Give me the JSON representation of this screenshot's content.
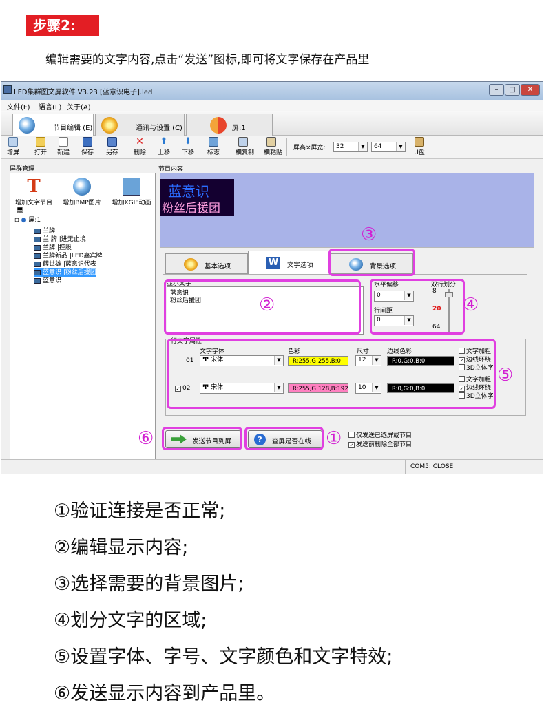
{
  "step": {
    "badge": "步骤2:",
    "instruction": "编辑需要的文字内容,点击“发送”图标,即可将文字保存在产品里"
  },
  "window": {
    "title": "LED集群图文屏软件 V3.23 [蓝意识电子].led",
    "menu": [
      "文件(F)",
      "语言(L)",
      "关于(A)"
    ],
    "tabs": [
      {
        "label": "节目编辑 (E)",
        "icon": "palette-icon"
      },
      {
        "label": "通讯与设置 (C)",
        "icon": "gear-icon"
      },
      {
        "label": "屏:1",
        "icon": "refresh-icon"
      }
    ],
    "toolbar": [
      "增屏",
      "打开",
      "新建",
      "保存",
      "另存",
      "删除",
      "上移",
      "下移",
      "标志",
      "横复制",
      "横粘贴"
    ],
    "screen_size": {
      "label": "屏高×屏宽:",
      "height": "32",
      "width": "64"
    },
    "udisk": "U盘"
  },
  "left_panel": {
    "title": "屏群管理",
    "tools": [
      "增加文字节目",
      "增加BMP图片",
      "增加XGIF动画"
    ],
    "tree_root": "屏:1",
    "programs": [
      "兰牌",
      "兰 牌 |进无止境",
      "兰牌 |控股",
      "兰牌新品 |LED嘉宾牌",
      "薛世雄 |蓝意识代表",
      "蓝意识 |粉丝后援团",
      "蓝意识"
    ],
    "selected_index": 5
  },
  "content": {
    "title": "节目内容",
    "preview_line1": "蓝意识",
    "preview_line2": "粉丝后援团",
    "prop_tabs": [
      "基本选项",
      "文字选项",
      "背景选项"
    ],
    "display_text_label": "显示文字",
    "display_text_line1": "蓝意识",
    "display_text_line2": "粉丝后援团",
    "h_offset_label": "水平偏移",
    "h_offset": "0",
    "line_spacing_label": "行间距",
    "line_spacing": "0",
    "double_line_label": "双行划分",
    "slider_top": "8",
    "slider_value": "20",
    "slider_bottom": "64",
    "line_attr_label": "行文字属性",
    "col_font": "文字字体",
    "col_color": "色彩",
    "col_size": "尺寸",
    "col_border": "边线色彩",
    "rows": [
      {
        "num": "01",
        "checked": false,
        "font": "宋体",
        "color": "R:255,G:255,B:0",
        "color_hex": "#ffff00",
        "size": "12",
        "border": "R:0,G:0,B:0",
        "opts": [
          {
            "label": "文字加粗",
            "on": false
          },
          {
            "label": "边线环绕",
            "on": true
          },
          {
            "label": "3D立体字",
            "on": false
          }
        ]
      },
      {
        "num": "02",
        "checked": true,
        "font": "宋体",
        "color": "R:255,G:128,B:192",
        "color_hex": "#ff80c0",
        "size": "10",
        "border": "R:0,G:0,B:0",
        "opts": [
          {
            "label": "文字加粗",
            "on": false
          },
          {
            "label": "边线环绕",
            "on": true
          },
          {
            "label": "3D立体字",
            "on": false
          }
        ]
      }
    ],
    "send_button": "发送节目到屏",
    "check_button": "查屏是否在线",
    "opt_only_selected": "仅发送已选屏或节目",
    "opt_delete_before": "发送前删除全部节目"
  },
  "status": "COM5: CLOSE",
  "markers": [
    "①",
    "②",
    "③",
    "④",
    "⑤",
    "⑥"
  ],
  "summary": [
    "①验证连接是否正常;",
    "②编辑显示内容;",
    "③选择需要的背景图片;",
    "④划分文字的区域;",
    "⑤设置字体、字号、文字颜色和文字特效;",
    "⑥发送显示内容到产品里。"
  ],
  "colors": {
    "step_badge": "#e31e24",
    "highlight": "#e040e0",
    "led_bg": "#140030",
    "led_line1": "#2b6cff",
    "led_line2": "#ff9fe0"
  }
}
